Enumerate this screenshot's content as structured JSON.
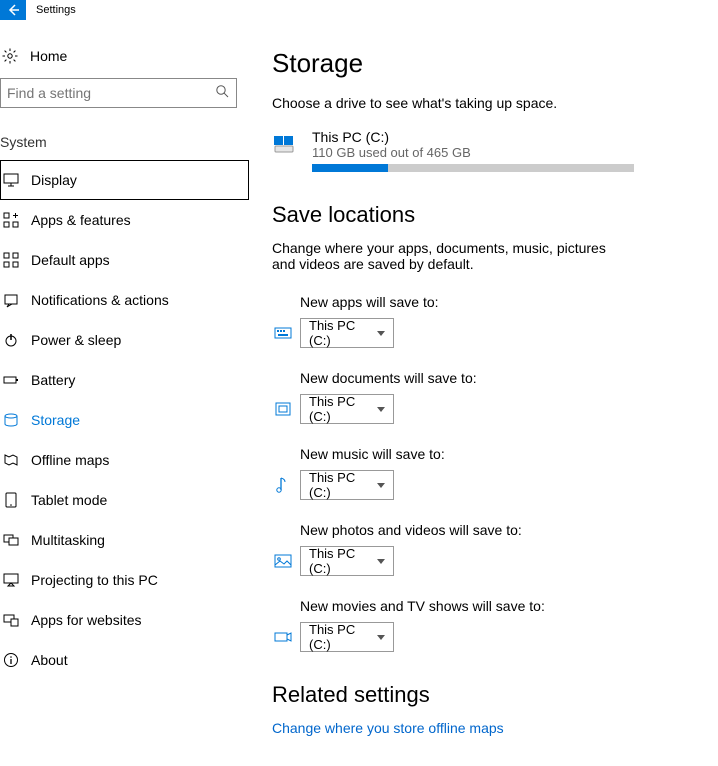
{
  "titlebar": {
    "title": "Settings"
  },
  "sidebar": {
    "home_label": "Home",
    "search_placeholder": "Find a setting",
    "section_label": "System",
    "items": [
      {
        "label": "Display"
      },
      {
        "label": "Apps & features"
      },
      {
        "label": "Default apps"
      },
      {
        "label": "Notifications & actions"
      },
      {
        "label": "Power & sleep"
      },
      {
        "label": "Battery"
      },
      {
        "label": "Storage"
      },
      {
        "label": "Offline maps"
      },
      {
        "label": "Tablet mode"
      },
      {
        "label": "Multitasking"
      },
      {
        "label": "Projecting to this PC"
      },
      {
        "label": "Apps for websites"
      },
      {
        "label": "About"
      }
    ]
  },
  "page": {
    "heading": "Storage",
    "intro": "Choose a drive to see what's taking up space.",
    "drive": {
      "name": "This PC (C:)",
      "usage_text": "110 GB used out of 465 GB",
      "used_gb": 110,
      "total_gb": 465
    },
    "save_heading": "Save locations",
    "save_intro": "Change where your apps, documents, music, pictures and videos are saved by default.",
    "save_items": [
      {
        "label": "New apps will save to:",
        "value": "This PC (C:)"
      },
      {
        "label": "New documents will save to:",
        "value": "This PC (C:)"
      },
      {
        "label": "New music will save to:",
        "value": "This PC (C:)"
      },
      {
        "label": "New photos and videos will save to:",
        "value": "This PC (C:)"
      },
      {
        "label": "New movies and TV shows will save to:",
        "value": "This PC (C:)"
      }
    ],
    "related_heading": "Related settings",
    "related_link": "Change where you store offline maps"
  }
}
